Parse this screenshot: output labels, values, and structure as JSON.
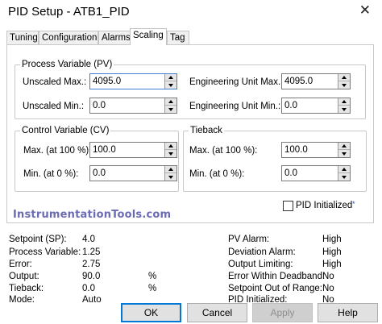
{
  "window": {
    "title": "PID Setup - ATB1_PID",
    "close_glyph": "✕"
  },
  "tabs": [
    {
      "label": "Tuning"
    },
    {
      "label": "Configuration"
    },
    {
      "label": "Alarms"
    },
    {
      "label": "Scaling",
      "active": true
    },
    {
      "label": "Tag"
    }
  ],
  "scaling": {
    "pv": {
      "title": "Process Variable (PV)",
      "unscaled_max_label": "Unscaled Max.:",
      "unscaled_max": "4095.0",
      "unscaled_min_label": "Unscaled Min.:",
      "unscaled_min": "0.0",
      "eng_max_label": "Engineering Unit Max.:",
      "eng_max": "4095.0",
      "eng_min_label": "Engineering Unit Min.:",
      "eng_min": "0.0"
    },
    "cv": {
      "title": "Control Variable (CV)",
      "max_label": "Max. (at 100 %):",
      "max": "100.0",
      "min_label": "Min. (at 0 %):",
      "min": "0.0"
    },
    "tieback": {
      "title": "Tieback",
      "max_label": "Max. (at 100 %):",
      "max": "100.0",
      "min_label": "Min. (at 0 %):",
      "min": "0.0"
    },
    "pid_initialized_label": "PID Initialized",
    "pid_initialized_checked": false,
    "pid_initialized_marker": "*"
  },
  "watermark": "InstrumentationTools.com",
  "status_left": [
    {
      "label": "Setpoint (SP):",
      "value": "4.0",
      "unit": ""
    },
    {
      "label": "Process Variable:",
      "value": "1.25",
      "unit": ""
    },
    {
      "label": "Error:",
      "value": "2.75",
      "unit": ""
    },
    {
      "label": "Output:",
      "value": "90.0",
      "unit": "%"
    },
    {
      "label": "Tieback:",
      "value": "0.0",
      "unit": "%"
    },
    {
      "label": "Mode:",
      "value": "Auto",
      "unit": ""
    }
  ],
  "status_right": [
    {
      "label": "PV Alarm:",
      "value": "High"
    },
    {
      "label": "Deviation Alarm:",
      "value": "High"
    },
    {
      "label": "Output Limiting:",
      "value": "High"
    },
    {
      "label": "Error Within Deadband:",
      "value": "No"
    },
    {
      "label": "Setpoint Out of Range:",
      "value": "No"
    },
    {
      "label": "PID Initialized:",
      "value": "No"
    }
  ],
  "buttons": {
    "ok": "OK",
    "cancel": "Cancel",
    "apply": "Apply",
    "help": "Help"
  }
}
